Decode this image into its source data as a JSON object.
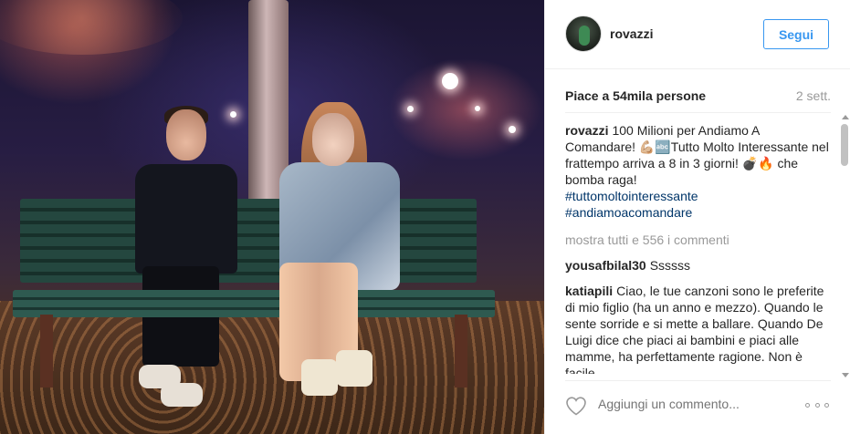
{
  "post": {
    "username": "rovazzi",
    "follow_label": "Segui",
    "likes": "Piace a 54mila persone",
    "time": "2 sett."
  },
  "caption": {
    "user": "rovazzi",
    "text": "100 Milioni per Andiamo A Comandare! 💪🏼🔤Tutto Molto Interessante nel frattempo arriva a 8 in 3 giorni! 💣🔥 che bomba raga!",
    "tag1": "#tuttomoltointeressante",
    "tag2": "#andiamoacomandare"
  },
  "load_more": "mostra tutti e 556 i commenti",
  "comments": [
    {
      "user": "yousafbilal30",
      "text": "Ssssss"
    },
    {
      "user": "katiapili",
      "text": "Ciao, le tue canzoni sono le preferite di mio figlio (ha un anno e mezzo). Quando le sente sorride e si mette a ballare. Quando De Luigi dice che piaci ai bambini e piaci alle mamme, ha perfettamente ragione. Non è facile"
    }
  ],
  "add_comment_placeholder": "Aggiungi un commento...",
  "icons": {
    "like": "heart-outline-icon",
    "options": "more-options-icon"
  },
  "colors": {
    "accent": "#3897f0",
    "hashtag": "#003569",
    "muted": "#999999"
  }
}
